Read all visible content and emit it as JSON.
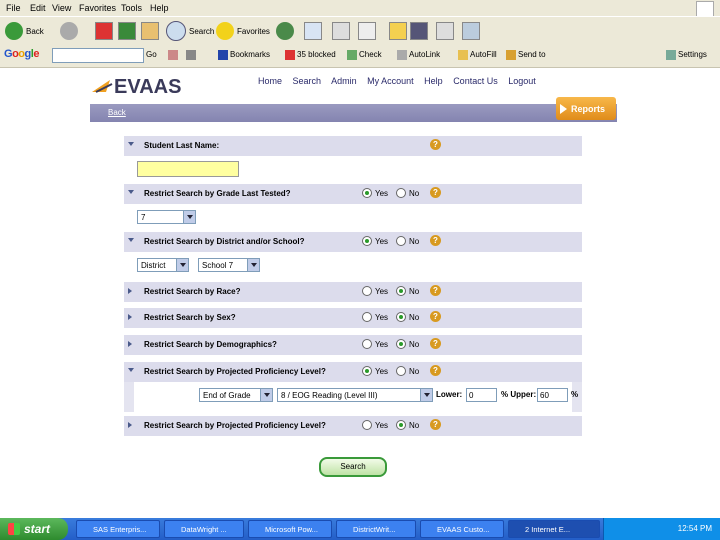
{
  "menu": [
    "File",
    "Edit",
    "View",
    "Favorites",
    "Tools",
    "Help"
  ],
  "toolbar": {
    "back": "Back",
    "search": "Search",
    "favorites": "Favorites"
  },
  "google_bar": {
    "logo": "Google",
    "go": "Go",
    "bookmarks": "Bookmarks",
    "blocked": "35 blocked",
    "check": "Check",
    "autolink": "AutoLink",
    "autofill": "AutoFill",
    "send_to": "Send to",
    "settings": "Settings"
  },
  "evaas": {
    "logo": "EVAAS",
    "nav": [
      "Home",
      "Search",
      "Admin",
      "My Account",
      "Help",
      "Contact Us",
      "Logout"
    ],
    "back": "Back",
    "reports": "Reports"
  },
  "form": {
    "student_last_name": "Student Last Name:",
    "grade": {
      "label": "Restrict Search by Grade Last Tested?",
      "value": "7"
    },
    "district": {
      "label": "Restrict Search by District and/or School?",
      "district_value": "District",
      "school_value": "School 7"
    },
    "race": "Restrict Search by Race?",
    "sex": "Restrict Search by Sex?",
    "demographics": "Restrict Search by Demographics?",
    "proficiency": {
      "label": "Restrict Search by Projected Proficiency Level?",
      "test_value": "End of Grade",
      "subject_value": "8 / EOG Reading (Level III)",
      "lower_label": "Lower:",
      "lower_value": "0",
      "upper_label": "% Upper:",
      "upper_value": "60",
      "pct": "%"
    },
    "proficiency2": "Restrict Search by Projected Proficiency Level?",
    "yes": "Yes",
    "no": "No",
    "help": "?",
    "search_button": "Search"
  },
  "taskbar": {
    "start": "start",
    "tasks": [
      "SAS Enterpris...",
      "DataWright ...",
      "Microsoft Pow...",
      "DistrictWrit...",
      "EVAAS Custo...",
      "2 Internet E..."
    ],
    "clock": "12:54 PM"
  },
  "colors": {
    "form_row": "#dcdcec",
    "evaas_bar": "#8888b4",
    "reports": "#e89a2a",
    "search_border": "#3a9a3a"
  }
}
